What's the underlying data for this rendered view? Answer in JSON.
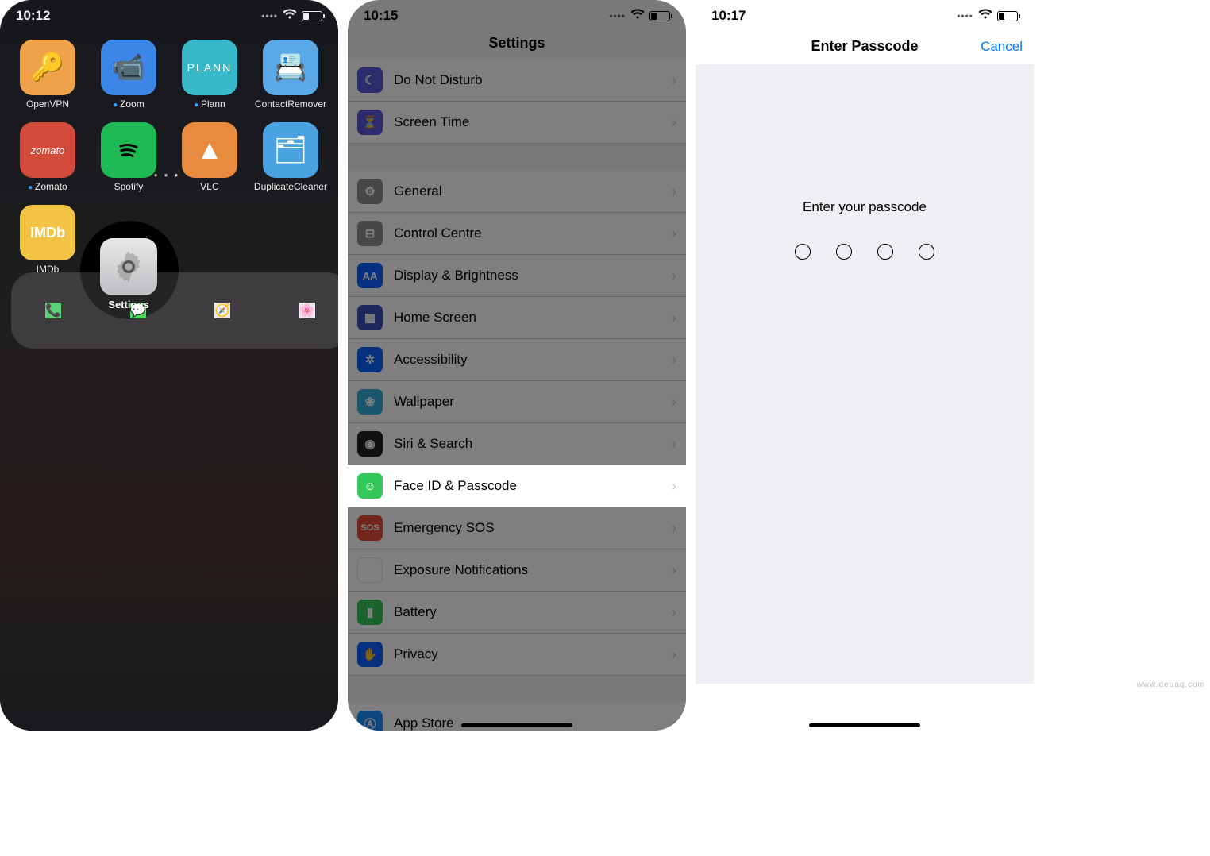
{
  "watermark": "www.deuaq.com",
  "panel1": {
    "time": "10:12",
    "highlighted_app": "Settings",
    "apps": [
      {
        "label": "OpenVPN",
        "icon": "openvpn",
        "has_dot": false
      },
      {
        "label": "Zoom",
        "icon": "zoom",
        "has_dot": true
      },
      {
        "label": "Plann",
        "icon": "plann",
        "has_dot": true
      },
      {
        "label": "ContactRemover",
        "icon": "contactremover",
        "has_dot": false
      },
      {
        "label": "Zomato",
        "icon": "zomato",
        "has_dot": true
      },
      {
        "label": "Spotify",
        "icon": "spotify",
        "has_dot": false
      },
      {
        "label": "VLC",
        "icon": "vlc",
        "has_dot": false
      },
      {
        "label": "DuplicateCleaner",
        "icon": "duplicatecleaner",
        "has_dot": false
      },
      {
        "label": "IMDb",
        "icon": "imdb",
        "has_dot": false
      }
    ],
    "dock": [
      "Phone",
      "Messages",
      "Safari",
      "Photos"
    ],
    "page_index": 3,
    "page_count": 3
  },
  "panel2": {
    "time": "10:15",
    "title": "Settings",
    "highlighted_row": "Face ID & Passcode",
    "groups": [
      [
        {
          "label": "Do Not Disturb",
          "icon": "moon"
        },
        {
          "label": "Screen Time",
          "icon": "hourglass"
        }
      ],
      [
        {
          "label": "General",
          "icon": "gear"
        },
        {
          "label": "Control Centre",
          "icon": "switches"
        },
        {
          "label": "Display & Brightness",
          "icon": "AA"
        },
        {
          "label": "Home Screen",
          "icon": "grid"
        },
        {
          "label": "Accessibility",
          "icon": "figure"
        },
        {
          "label": "Wallpaper",
          "icon": "flower"
        },
        {
          "label": "Siri & Search",
          "icon": "siri"
        },
        {
          "label": "Face ID & Passcode",
          "icon": "faceid"
        },
        {
          "label": "Emergency SOS",
          "icon": "SOS"
        },
        {
          "label": "Exposure Notifications",
          "icon": "exposure"
        },
        {
          "label": "Battery",
          "icon": "battery"
        },
        {
          "label": "Privacy",
          "icon": "hand"
        }
      ],
      [
        {
          "label": "App Store",
          "icon": "appstore"
        }
      ]
    ]
  },
  "panel3": {
    "time": "10:17",
    "title": "Enter Passcode",
    "cancel": "Cancel",
    "prompt": "Enter your passcode",
    "digits": 4
  }
}
